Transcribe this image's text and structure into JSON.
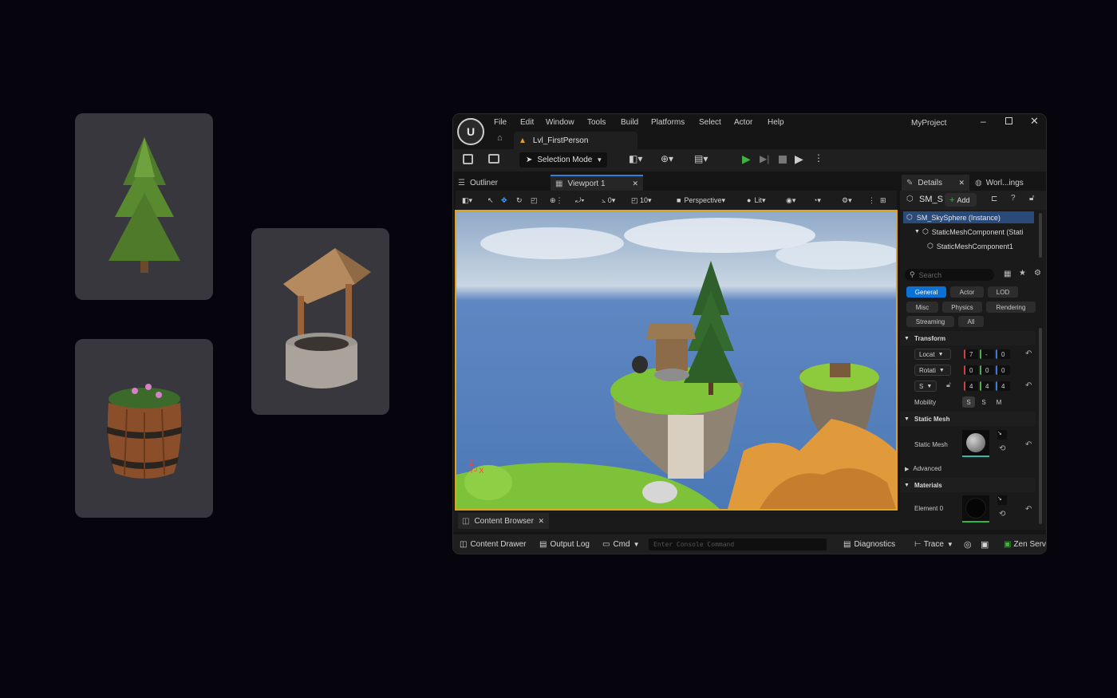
{
  "app": {
    "project": "MyProject",
    "level_tab": "Lvl_FirstPerson"
  },
  "menu": [
    "File",
    "Edit",
    "Window",
    "Tools",
    "Build",
    "Platforms",
    "Select",
    "Actor",
    "Help"
  ],
  "toolbar": {
    "mode": "Selection Mode"
  },
  "panels": {
    "outliner": "Outliner",
    "viewport": "Viewport 1",
    "details": "Details",
    "world": "Worl...ings",
    "content_browser": "Content Browser"
  },
  "viewport_bar": {
    "rot_snap": "0",
    "scale_snap": "10",
    "view": "Perspective",
    "lit": "Lit"
  },
  "details": {
    "actor_name": "SM_S",
    "add_label": "Add",
    "tree": [
      "SM_SkySphere (Instance)",
      "StaticMeshComponent (Stati",
      "StaticMeshComponent1"
    ],
    "search_placeholder": "Search",
    "filters": [
      "General",
      "Actor",
      "LOD",
      "Misc",
      "Physics",
      "Rendering",
      "Streaming",
      "All"
    ],
    "transform_header": "Transform",
    "location": {
      "label": "Locat",
      "values": [
        "7",
        "-",
        "0"
      ]
    },
    "rotation": {
      "label": "Rotati",
      "values": [
        "0",
        "0",
        "0"
      ]
    },
    "scale": {
      "label": "S",
      "values": [
        "4",
        "4",
        "4"
      ]
    },
    "mobility": {
      "label": "Mobility",
      "options": [
        "S",
        "S",
        "M"
      ]
    },
    "static_mesh_header": "Static Mesh",
    "static_mesh_label": "Static Mesh",
    "advanced": "Advanced",
    "materials_header": "Materials",
    "element0": "Element 0"
  },
  "statusbar": {
    "content_drawer": "Content Drawer",
    "output_log": "Output Log",
    "cmd": "Cmd",
    "console_placeholder": "Enter Console Command",
    "diagnostics": "Diagnostics",
    "trace": "Trace",
    "zen": "Zen Serv"
  },
  "colors": {
    "accent_blue": "#0a72d6",
    "play_green": "#3fb23f",
    "viewport_border": "#e0a21f"
  }
}
